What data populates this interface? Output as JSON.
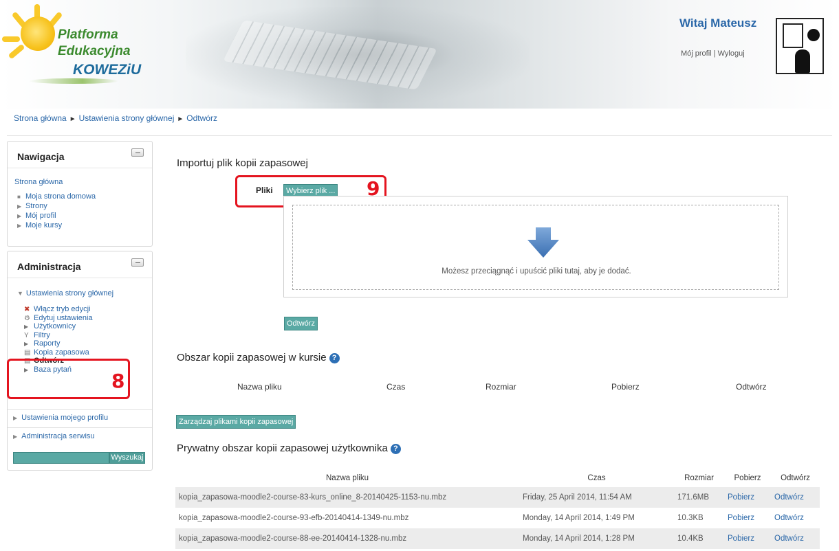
{
  "header": {
    "logo": {
      "line1": "Platforma",
      "line2": "Edukacyjna",
      "line3": "KOWEZiU"
    },
    "welcome": "Witaj Mateusz",
    "profile_link": "Mój profil",
    "separator": "|",
    "logout_link": "Wyloguj"
  },
  "breadcrumb": {
    "items": [
      "Strona główna",
      "Ustawienia strony głównej",
      "Odtwórz"
    ],
    "separator": "►"
  },
  "sidebar": {
    "navigation": {
      "title": "Nawigacja",
      "home": "Strona główna",
      "items": [
        "Moja strona domowa",
        "Strony",
        "Mój profil",
        "Moje kursy"
      ]
    },
    "administration": {
      "title": "Administracja",
      "section": "Ustawienia strony głównej",
      "items": [
        "Włącz tryb edycji",
        "Edytuj ustawienia",
        "Użytkownicy",
        "Filtry",
        "Raporty",
        "Kopia zapasowa",
        "Odtwórz",
        "Baza pytań"
      ],
      "profile_settings": "Ustawienia mojego profilu",
      "site_admin": "Administracja serwisu",
      "search_button": "Wyszukaj",
      "search_value": ""
    }
  },
  "callouts": {
    "step_sidebar": "8",
    "step_file": "9"
  },
  "main": {
    "import_title": "Importuj plik kopii zapasowej",
    "files_label": "Pliki",
    "choose_file_button": "Wybierz plik ...",
    "drop_text": "Możesz przeciągnąć i upuścić pliki tutaj, aby je dodać.",
    "restore_button": "Odtwórz",
    "course_area_title": "Obszar kopii zapasowej w kursie",
    "course_area_columns": [
      "Nazwa pliku",
      "Czas",
      "Rozmiar",
      "Pobierz",
      "Odtwórz"
    ],
    "manage_button": "Zarządzaj plikami kopii zapasowej",
    "private_area_title": "Prywatny obszar kopii zapasowej użytkownika",
    "private_area_columns": [
      "Nazwa pliku",
      "Czas",
      "Rozmiar",
      "Pobierz",
      "Odtwórz"
    ],
    "private_rows": [
      {
        "file": "kopia_zapasowa-moodle2-course-83-kurs_online_8-20140425-1153-nu.mbz",
        "time": "Friday, 25 April 2014, 11:54 AM",
        "size": "171.6MB",
        "download": "Pobierz",
        "restore": "Odtwórz"
      },
      {
        "file": "kopia_zapasowa-moodle2-course-93-efb-20140414-1349-nu.mbz",
        "time": "Monday, 14 April 2014, 1:49 PM",
        "size": "10.3KB",
        "download": "Pobierz",
        "restore": "Odtwórz"
      },
      {
        "file": "kopia_zapasowa-moodle2-course-88-ee-20140414-1328-nu.mbz",
        "time": "Monday, 14 April 2014, 1:28 PM",
        "size": "10.4KB",
        "download": "Pobierz",
        "restore": "Odtwórz"
      }
    ]
  },
  "colors": {
    "link": "#2a67a8",
    "button_teal": "#5aa9a4",
    "callout_red": "#e4141f",
    "help_blue": "#2d6fb5"
  }
}
